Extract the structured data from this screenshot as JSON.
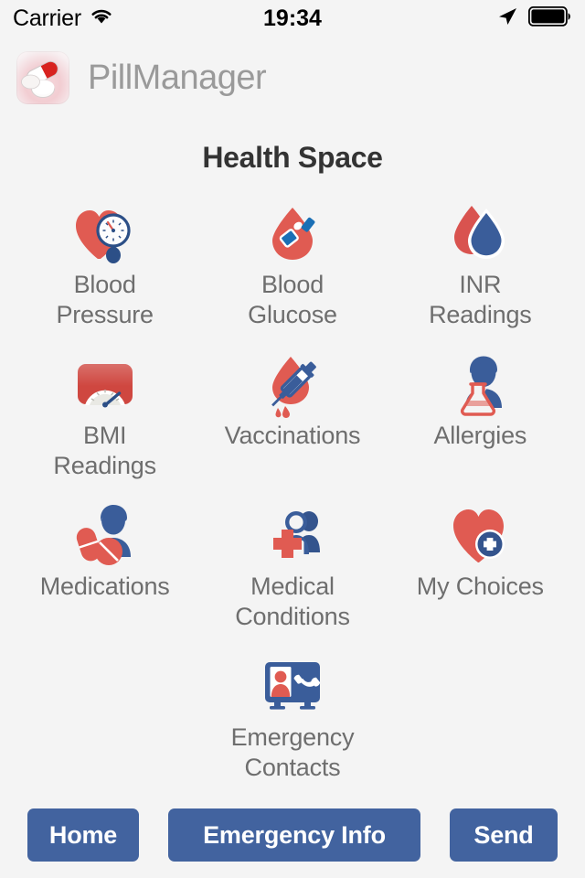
{
  "status_bar": {
    "carrier": "Carrier",
    "wifi_icon": "wifi-icon",
    "time": "19:34",
    "location_icon": "location-arrow-icon",
    "battery_icon": "battery-full-icon"
  },
  "app_header": {
    "icon": "pill-app-icon",
    "title": "PillManager"
  },
  "page": {
    "title": "Health Space"
  },
  "colors": {
    "background": "#f4f4f4",
    "red": "#e05b52",
    "blue": "#3a5d9a",
    "button_blue": "#42639f",
    "label_grey": "#6e6e6e",
    "title_grey": "#333333",
    "app_title_grey": "#9a9a9a"
  },
  "grid": {
    "items": [
      {
        "label": "Blood\nPressure",
        "icon": "blood-pressure-icon"
      },
      {
        "label": "Blood\nGlucose",
        "icon": "blood-glucose-icon"
      },
      {
        "label": "INR\nReadings",
        "icon": "inr-readings-icon"
      },
      {
        "label": "BMI\nReadings",
        "icon": "bmi-readings-icon"
      },
      {
        "label": "Vaccinations",
        "icon": "vaccinations-icon"
      },
      {
        "label": "Allergies",
        "icon": "allergies-icon"
      },
      {
        "label": "Medications",
        "icon": "medications-icon"
      },
      {
        "label": "Medical\nConditions",
        "icon": "medical-conditions-icon"
      },
      {
        "label": "My Choices",
        "icon": "my-choices-icon"
      },
      {
        "label": "Emergency\nContacts",
        "icon": "emergency-contacts-icon"
      }
    ]
  },
  "toolbar": {
    "home_label": "Home",
    "emergency_info_label": "Emergency Info",
    "send_label": "Send"
  }
}
